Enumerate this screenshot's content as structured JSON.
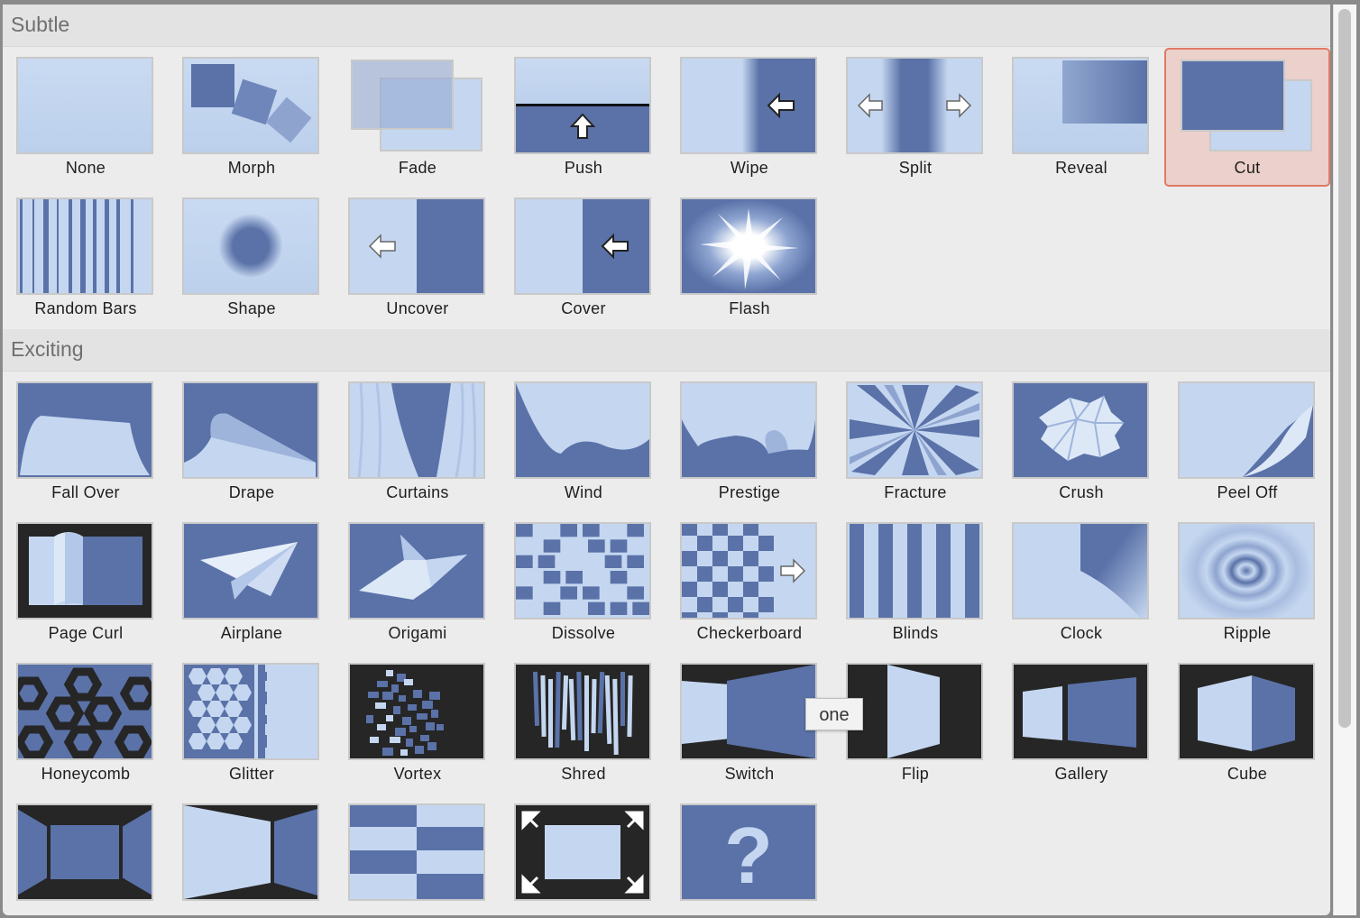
{
  "sections": [
    {
      "title": "Subtle"
    },
    {
      "title": "Exciting"
    }
  ],
  "transitions": {
    "none": "None",
    "morph": "Morph",
    "fade": "Fade",
    "push": "Push",
    "wipe": "Wipe",
    "split": "Split",
    "reveal": "Reveal",
    "cut": "Cut",
    "random_bars": "Random Bars",
    "shape": "Shape",
    "uncover": "Uncover",
    "cover": "Cover",
    "flash": "Flash",
    "fall_over": "Fall Over",
    "drape": "Drape",
    "curtains": "Curtains",
    "wind": "Wind",
    "prestige": "Prestige",
    "fracture": "Fracture",
    "crush": "Crush",
    "peel_off": "Peel Off",
    "page_curl": "Page Curl",
    "airplane": "Airplane",
    "origami": "Origami",
    "dissolve": "Dissolve",
    "checkerboard": "Checkerboard",
    "blinds": "Blinds",
    "clock": "Clock",
    "ripple": "Ripple",
    "honeycomb": "Honeycomb",
    "glitter": "Glitter",
    "vortex": "Vortex",
    "shred": "Shred",
    "switch": "Switch",
    "flip": "Flip",
    "gallery": "Gallery",
    "cube": "Cube"
  },
  "selected": "Cut",
  "tooltip": "one",
  "colors": {
    "light": "#c5d7f0",
    "dark": "#5a72a8",
    "frame": "#262626",
    "accent": "#e07a63"
  }
}
